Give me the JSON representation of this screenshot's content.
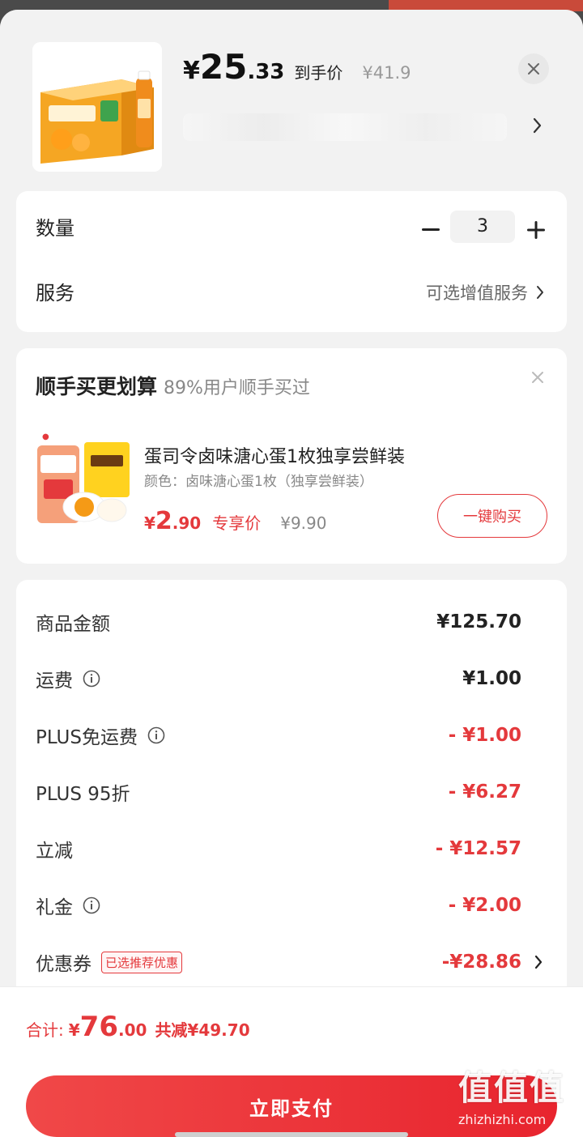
{
  "product": {
    "price_yen": "¥",
    "price_int": "25",
    "price_dec": ".33",
    "price_label": "到手价",
    "original_price": "¥41.9",
    "image_icon": "orange-juice-box-image"
  },
  "quantity": {
    "label": "数量",
    "value": "3"
  },
  "service": {
    "label": "服务",
    "link_text": "可选增值服务"
  },
  "upsell": {
    "title": "顺手买更划算",
    "subtitle": "89%用户顺手买过",
    "item_name": "蛋司令卤味溏心蛋1枚独享尝鲜装",
    "item_spec": "颜色：卤味溏心蛋1枚（独享尝鲜装）",
    "price_yen": "¥",
    "price_int": "2",
    "price_dec": ".90",
    "price_label": "专享价",
    "original_price": "¥9.90",
    "buy_button": "一键购买",
    "image_icon": "marinated-egg-image"
  },
  "summary": {
    "rows": [
      {
        "label": "商品金额",
        "value": "¥125.70"
      },
      {
        "label": "运费",
        "value": "¥1.00"
      },
      {
        "label": "PLUS免运费",
        "value": "- ¥1.00"
      },
      {
        "label": "PLUS 95折",
        "value": "- ¥6.27"
      },
      {
        "label": "立减",
        "value": "- ¥12.57"
      },
      {
        "label": "礼金",
        "value": "- ¥2.00"
      },
      {
        "label": "优惠券",
        "value": "-¥28.86",
        "tag": "已选推荐优惠"
      }
    ]
  },
  "footer": {
    "total_label": "合计:",
    "total_yen": "¥",
    "total_int": "76",
    "total_dec": ".00",
    "reduce_text": "共减¥49.70",
    "pay_button": "立即支付"
  },
  "watermark": {
    "logo": "值值值",
    "site": "zhizhizhi.com"
  },
  "colors": {
    "accent": "#e4393c",
    "background": "#f2f2f2"
  }
}
